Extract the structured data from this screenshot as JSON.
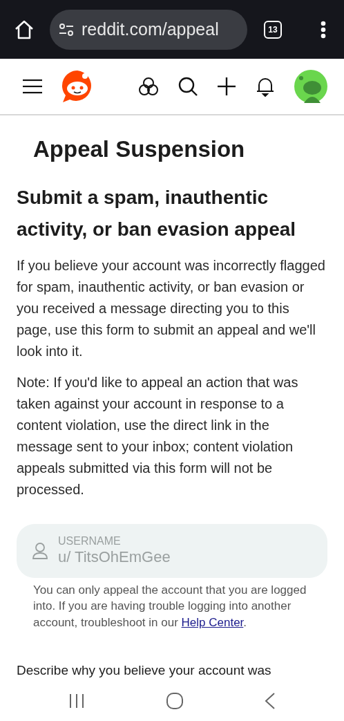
{
  "browser": {
    "url": "reddit.com/appeal",
    "tab_count": "13"
  },
  "page": {
    "title": "Appeal Suspension",
    "heading": "Submit a spam, inauthentic activity, or ban evasion appeal",
    "paragraphs": [
      "If you believe your account was incorrectly flagged for spam, inauthentic activity, or ban evasion or you received a message directing you to this page, use this form to submit an appeal and we'll look into it.",
      "Note: If you'd like to appeal an action that was taken against your account in response to a content violation, use the direct link in the message sent to your inbox; content violation appeals submitted via this form will not be processed."
    ],
    "username_field": {
      "label": "USERNAME",
      "value": "u/ TitsOhEmGee",
      "disabled": true
    },
    "helper": {
      "text": "You can only appeal the account that you are logged into. If you are having trouble logging into another account, troubleshoot in our",
      "link": "Help Center",
      "after": "."
    },
    "question": "Describe why you believe your account was"
  }
}
